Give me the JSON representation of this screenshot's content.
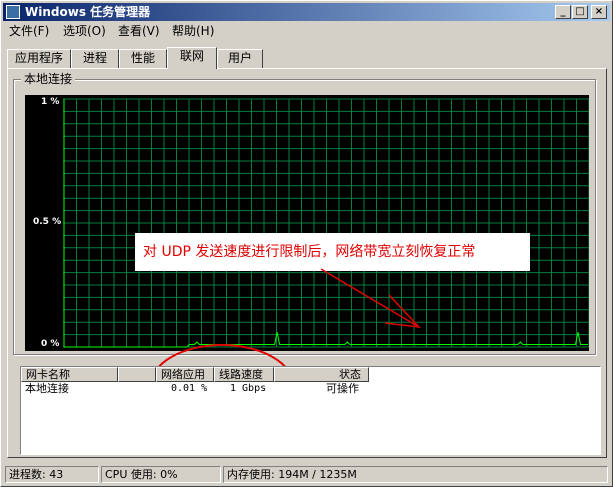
{
  "window": {
    "title": "Windows 任务管理器",
    "buttons": {
      "minimize": "_",
      "maximize": "□",
      "close": "×"
    }
  },
  "menu": {
    "items": [
      "文件(F)",
      "选项(O)",
      "查看(V)",
      "帮助(H)"
    ]
  },
  "tabs": {
    "items": [
      "应用程序",
      "进程",
      "性能",
      "联网",
      "用户"
    ],
    "active": "联网"
  },
  "graph": {
    "group_label": "本地连接",
    "y_labels": [
      "1 %",
      "0.5 %",
      "0 %"
    ]
  },
  "chart_data": {
    "type": "line",
    "ylim": [
      0,
      1
    ],
    "grid": true,
    "y_ticks": [
      "1 %",
      "0.5 %",
      "0 %"
    ],
    "series": [
      {
        "color": "#ffff00",
        "values": [
          0,
          0,
          0,
          0,
          0,
          0,
          0,
          0,
          0,
          0,
          0,
          0,
          0,
          0,
          0,
          0,
          0,
          0,
          0,
          0,
          0,
          0,
          0,
          0,
          0,
          0,
          0,
          0,
          0,
          0,
          0,
          0,
          0,
          0,
          0,
          0,
          0,
          0,
          0,
          0,
          0,
          0,
          0,
          0,
          0,
          0,
          0,
          0,
          0,
          0,
          0.01,
          0.01,
          0.01,
          0.02,
          0.01,
          0.01,
          0.01,
          0.01,
          0.01,
          0.01,
          0.01,
          0.01,
          0.01,
          0.01,
          0.01,
          0.01,
          0.01,
          0.01,
          0.01,
          0.01,
          0.01,
          0.01,
          0.01,
          0.01,
          0.01,
          0.01,
          0.01,
          0.01,
          0.01,
          0.01,
          0.01,
          0.01,
          0.01,
          0.01,
          0.01,
          0.06,
          0.01,
          0.01,
          0.01,
          0.01,
          0.01,
          0.01,
          0.01,
          0.01,
          0.01,
          0.01,
          0.01,
          0.01,
          0.01,
          0.01,
          0.01,
          0.01,
          0.01,
          0.01,
          0.01,
          0.01,
          0.01,
          0.01,
          0.01,
          0.01,
          0.01,
          0.01,
          0.01,
          0.02,
          0.01,
          0.01,
          0.01,
          0.01,
          0.01,
          0.01,
          0.01,
          0.01,
          0.01,
          0.01,
          0.01,
          0.01,
          0.01,
          0.01,
          0.01,
          0.01,
          0.01,
          0.01,
          0.01,
          0.01,
          0.01,
          0.01,
          0.01,
          0.01,
          0.01,
          0.01,
          0.01,
          0.01,
          0.01,
          0.01,
          0.01,
          0.01,
          0.01,
          0.01,
          0.01,
          0.01,
          0.01,
          0.01,
          0.01,
          0.01,
          0.01,
          0.01,
          0.01,
          0.01,
          0.01,
          0.01,
          0.01,
          0.01,
          0.01,
          0.01,
          0.01,
          0.01,
          0.01,
          0.01,
          0.01,
          0.01,
          0.01,
          0.01,
          0.01,
          0.01,
          0.01,
          0.01,
          0.01,
          0.01,
          0.01,
          0.01,
          0.01,
          0.01,
          0.02,
          0.01,
          0.01,
          0.01,
          0.01,
          0.01,
          0.01,
          0.01,
          0.01,
          0.01,
          0.01,
          0.01,
          0.01,
          0.01,
          0.01,
          0.01,
          0.01,
          0.01,
          0.01,
          0.01,
          0.01,
          0.01,
          0.01,
          0.06,
          0.01,
          0.01,
          0.01,
          0.01
        ]
      }
    ],
    "line_color": "#00ff00",
    "grid_color": "#008040",
    "background": "#000000"
  },
  "annotation": {
    "text": "对 UDP 发送速度进行限制后，网络带宽立刻恢复正常",
    "color": "#e00000"
  },
  "adapters": {
    "columns": [
      "网卡名称",
      "网络应用",
      "线路速度",
      "状态"
    ],
    "rows": [
      {
        "name": "本地连接",
        "utilization": "0.01 %",
        "link_speed": "1 Gbps",
        "state": "可操作"
      }
    ]
  },
  "status": {
    "processes": "进程数: 43",
    "cpu": "CPU 使用: 0%",
    "memory": "内存使用: 194M / 1235M"
  }
}
